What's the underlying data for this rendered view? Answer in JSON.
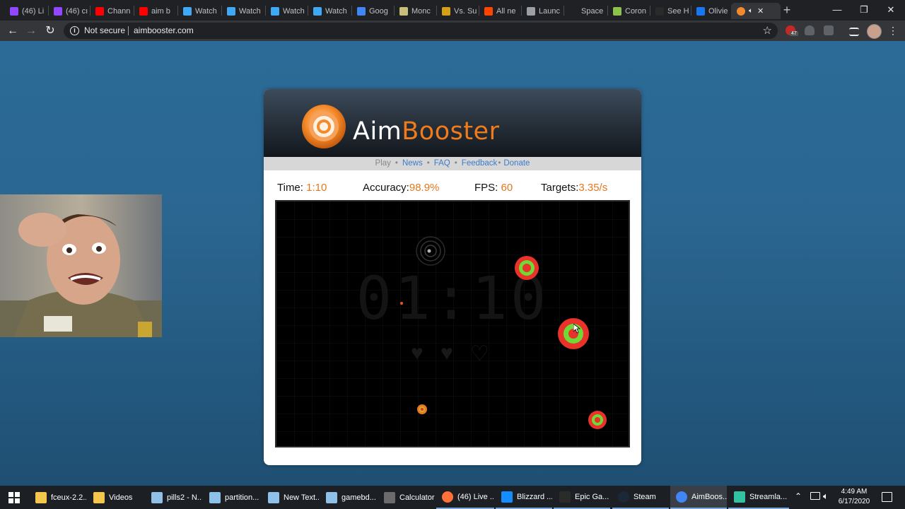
{
  "browser": {
    "tabs": [
      {
        "label": "(46) Li",
        "icon": "twitch-icon",
        "color": "#9146ff"
      },
      {
        "label": "(46) cı",
        "icon": "twitch-icon",
        "color": "#9146ff"
      },
      {
        "label": "Chann",
        "icon": "youtube-icon",
        "color": "#ff0000"
      },
      {
        "label": "aim b",
        "icon": "youtube-icon",
        "color": "#ff0000"
      },
      {
        "label": "Watch",
        "icon": "watch-icon",
        "color": "#3fa9f5"
      },
      {
        "label": "Watch",
        "icon": "watch-icon",
        "color": "#3fa9f5"
      },
      {
        "label": "Watch",
        "icon": "watch-icon",
        "color": "#3fa9f5"
      },
      {
        "label": "Watch",
        "icon": "watch-icon",
        "color": "#3fa9f5"
      },
      {
        "label": "Goog",
        "icon": "google-icon",
        "color": "#4285f4"
      },
      {
        "label": "Monc",
        "icon": "monc-icon",
        "color": "#c8c07a"
      },
      {
        "label": "Vs. Su",
        "icon": "trophy-icon",
        "color": "#d4a017"
      },
      {
        "label": "All ne",
        "icon": "reddit-icon",
        "color": "#ff4500"
      },
      {
        "label": "Launc",
        "icon": "globe-icon",
        "color": "#9aa0a6"
      },
      {
        "label": "Space",
        "icon": "space-icon",
        "color": "#202124"
      },
      {
        "label": "Coron",
        "icon": "coron-icon",
        "color": "#8bc34a"
      },
      {
        "label": "See H",
        "icon": "seeh-icon",
        "color": "#2a2a2a"
      },
      {
        "label": "Olivie",
        "icon": "facebook-icon",
        "color": "#1877f2"
      }
    ],
    "active_tab_icon": "aimbooster-icon",
    "new_tab": "+",
    "window_controls": {
      "minimize": "—",
      "maximize": "❐",
      "close": "✕"
    },
    "nav": {
      "back": "←",
      "forward": "→",
      "reload": "↻"
    },
    "address": {
      "security": "Not secure",
      "url": "aimbooster.com"
    },
    "extension_badge": "47"
  },
  "aimbooster": {
    "logo": {
      "part1": "Aim",
      "part2": "Booster"
    },
    "nav": {
      "play": "Play",
      "news": "News",
      "faq": "FAQ",
      "feedback": "Feedback",
      "donate": "Donate"
    },
    "stats": {
      "time_label": "Time:",
      "time_value": "1:10",
      "accuracy_label": "Accuracy:",
      "accuracy_value": "98.9%",
      "fps_label": "FPS:",
      "fps_value": "60",
      "targets_label": "Targets:",
      "targets_value": "3.35/s"
    },
    "game": {
      "background_time": "01:10",
      "lives_total": 3,
      "lives_remaining": 2,
      "colors": {
        "outer": "#e8322a",
        "inner": "#6fd936",
        "small": "#e87a22"
      }
    }
  },
  "taskbar": {
    "items": [
      {
        "label": "fceux-2.2...",
        "icon": "folder-icon",
        "color": "#f3c64c"
      },
      {
        "label": "Videos",
        "icon": "folder-icon",
        "color": "#f3c64c"
      },
      {
        "label": "pills2 - N...",
        "icon": "notepad-icon",
        "color": "#8fc1e8"
      },
      {
        "label": "partition...",
        "icon": "notepad-icon",
        "color": "#8fc1e8"
      },
      {
        "label": "New Text...",
        "icon": "notepad-icon",
        "color": "#8fc1e8"
      },
      {
        "label": "gamebd...",
        "icon": "notepad-icon",
        "color": "#8fc1e8"
      },
      {
        "label": "Calculator",
        "icon": "calculator-icon",
        "color": "#6b6b6b"
      },
      {
        "label": "(46) Live ...",
        "icon": "firefox-icon",
        "color": "#ff7139"
      },
      {
        "label": "Blizzard ...",
        "icon": "blizzard-icon",
        "color": "#148eff"
      },
      {
        "label": "Epic Ga...",
        "icon": "epic-icon",
        "color": "#2b2b2b"
      },
      {
        "label": "Steam",
        "icon": "steam-icon",
        "color": "#1b2838"
      },
      {
        "label": "AimBoos...",
        "icon": "chrome-icon",
        "color": "#4285f4"
      },
      {
        "label": "Streamla...",
        "icon": "streamlabs-icon",
        "color": "#31c3a2"
      }
    ],
    "clock": {
      "time": "4:49 AM",
      "date": "6/17/2020"
    }
  }
}
